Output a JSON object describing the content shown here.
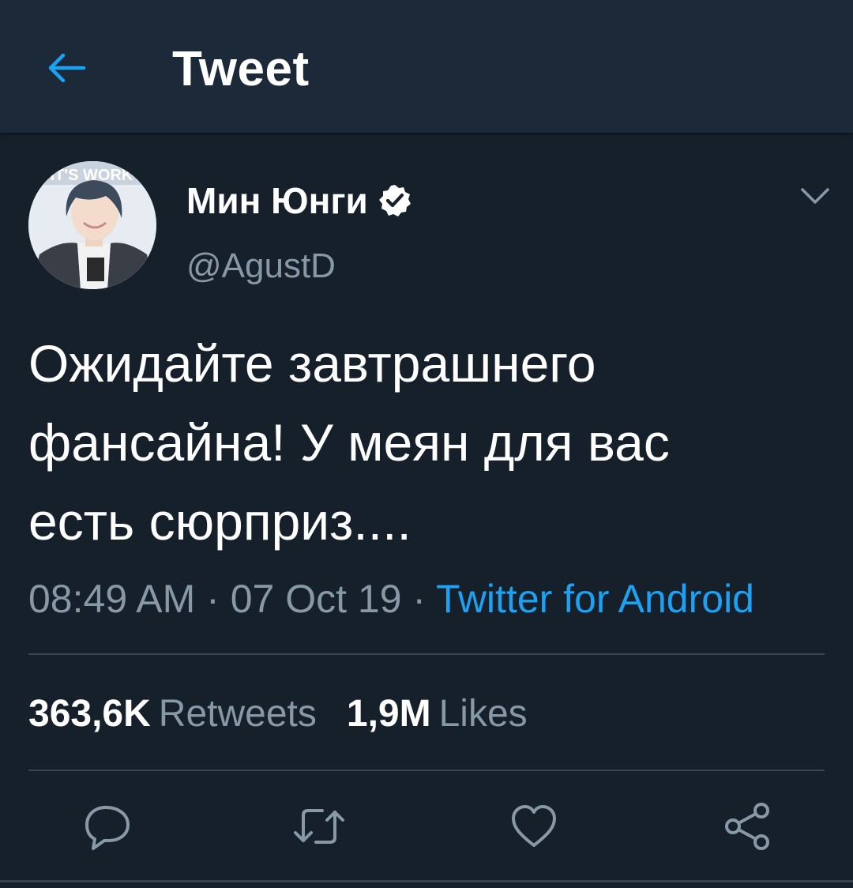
{
  "header": {
    "title": "Tweet",
    "back_icon": "arrow-left-icon"
  },
  "tweet": {
    "author": {
      "display_name": "Мин Юнги",
      "handle": "@AgustD",
      "verified": true,
      "avatar_banner_text": "IT'S WORK"
    },
    "text": "Ожидайте завтрашнего\nфансайна! У меян для вас\nесть сюрприз....",
    "time": "08:49 AM",
    "separator": " · ",
    "date": "07 Oct 19",
    "source": "Twitter for Android",
    "stats": {
      "retweets_count": "363,6K",
      "retweets_label": "Retweets",
      "likes_count": "1,9M",
      "likes_label": "Likes"
    }
  },
  "actions": [
    {
      "name": "reply",
      "icon": "reply-icon"
    },
    {
      "name": "retweet",
      "icon": "retweet-icon"
    },
    {
      "name": "like",
      "icon": "heart-icon"
    },
    {
      "name": "share",
      "icon": "share-icon"
    }
  ],
  "colors": {
    "background": "#15202b",
    "header_background": "#1c2938",
    "accent": "#1da1f2",
    "secondary_text": "#8899a6",
    "divider": "#38444d"
  }
}
